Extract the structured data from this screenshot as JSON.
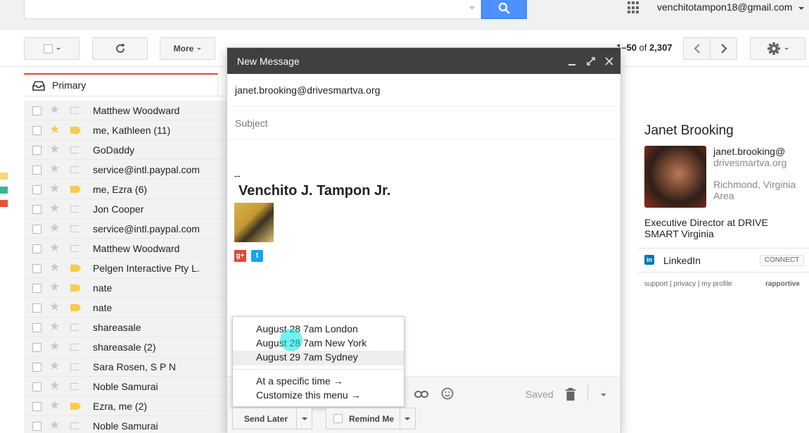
{
  "header": {
    "search_value": "",
    "account_email": "venchitotampon18@gmail.com"
  },
  "toolbar": {
    "more_label": "More",
    "pager_range": "1–50",
    "pager_of": "of",
    "pager_total": "2,307"
  },
  "tabs": {
    "primary_label": "Primary"
  },
  "emails": [
    {
      "sender": "Matthew Woodward",
      "starred": false,
      "important": false
    },
    {
      "sender": "me, Kathleen (11)",
      "starred": true,
      "important": true
    },
    {
      "sender": "GoDaddy",
      "starred": false,
      "important": false
    },
    {
      "sender": "service@intl.paypal.com",
      "starred": false,
      "important": false
    },
    {
      "sender": "me, Ezra (6)",
      "starred": false,
      "important": true
    },
    {
      "sender": "Jon Cooper",
      "starred": false,
      "important": false
    },
    {
      "sender": "service@intl.paypal.com",
      "starred": false,
      "important": false
    },
    {
      "sender": "Matthew Woodward",
      "starred": false,
      "important": false
    },
    {
      "sender": "Pelgen Interactive Pty L.",
      "starred": false,
      "important": true
    },
    {
      "sender": "nate",
      "starred": false,
      "important": true
    },
    {
      "sender": "nate",
      "starred": false,
      "important": true
    },
    {
      "sender": "shareasale",
      "starred": false,
      "important": false
    },
    {
      "sender": "shareasale (2)",
      "starred": false,
      "important": false
    },
    {
      "sender": "Sara Rosen, S P N",
      "starred": false,
      "important": false
    },
    {
      "sender": "Noble Samurai",
      "starred": false,
      "important": false
    },
    {
      "sender": "Ezra, me (2)",
      "starred": false,
      "important": true
    },
    {
      "sender": "Noble Samurai",
      "starred": false,
      "important": false
    }
  ],
  "compose": {
    "title": "New Message",
    "to": "janet.brooking@drivesmartva.org",
    "subject_placeholder": "Subject",
    "signature_dash": "--",
    "signature_name": "Venchito J. Tampon Jr.",
    "gplus_glyph": "g+",
    "twitter_glyph": "t",
    "saved_label": "Saved"
  },
  "send_later_menu": {
    "options": [
      "August 28 7am London",
      "August 28 7am New York",
      "August 29 7am Sydney",
      "At a specific time →",
      "Customize this menu →"
    ]
  },
  "buttons": {
    "send_later": "Send Later",
    "remind_me": "Remind Me"
  },
  "contact": {
    "name": "Janet Brooking",
    "email_line1": "janet.brooking@",
    "email_line2": "drivesmartva.org",
    "location": "Richmond, Virginia Area",
    "title": "Executive Director at DRIVE SMART Virginia",
    "linkedin_glyph": "in",
    "linkedin_label": "LinkedIn",
    "connect_label": "CONNECT",
    "support_label": "support",
    "privacy_label": "privacy",
    "profile_label": "my profile",
    "link_separator": "|",
    "brand": "rapportive"
  },
  "colors": {
    "accent": "#4d90fe",
    "header_dark": "#404040",
    "star": "#f7cb4d",
    "label_yellow": "#f7d77a",
    "label_teal": "#3bb39b",
    "label_red": "#e8532f"
  }
}
